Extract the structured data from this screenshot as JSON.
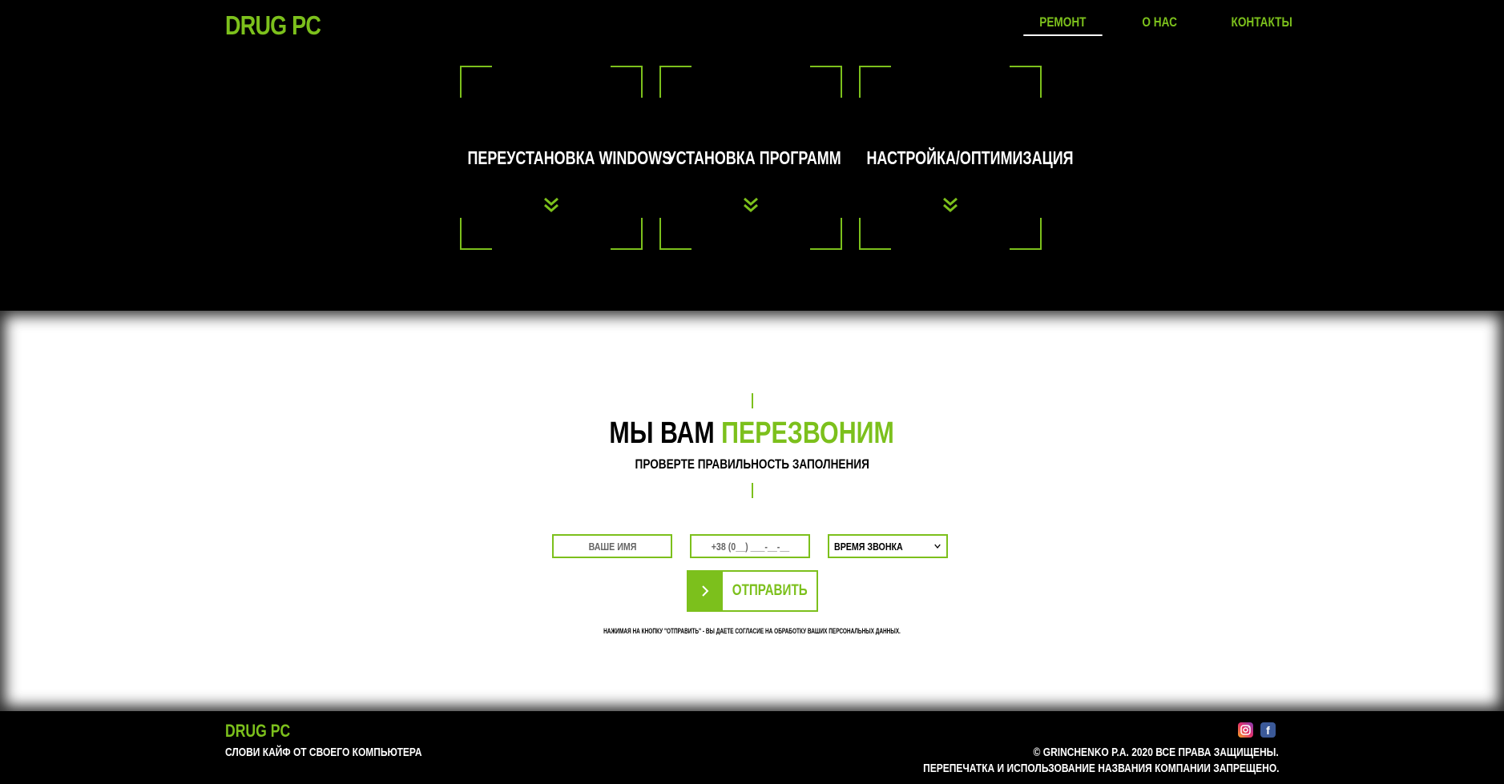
{
  "header": {
    "logo": "DRUG PC",
    "nav": [
      {
        "label": "РЕМОНТ",
        "active": true
      },
      {
        "label": "О НАС",
        "active": false
      },
      {
        "label": "КОНТАКТЫ",
        "active": false
      }
    ]
  },
  "services": [
    {
      "title": "ПЕРЕУСТАНОВКА WINDOWS",
      "icon": "double-chevron-down-icon"
    },
    {
      "title": "УСТАНОВКА ПРОГРАММ",
      "icon": "double-chevron-down-icon"
    },
    {
      "title": "НАСТРОЙКА/ОПТИМИЗАЦИЯ",
      "icon": "double-chevron-down-icon"
    }
  ],
  "callback": {
    "title_part1": "МЫ ВАМ",
    "title_part2": "ПЕРЕЗВОНИМ",
    "subtitle": "ПРОВЕРТЕ ПРАВИЛЬНОСТЬ ЗАПОЛНЕНИЯ",
    "name_placeholder": "ВАШЕ ИМЯ",
    "phone_placeholder": "+38 (0__) ___-__-__",
    "time_select": "ВРЕМЯ ЗВОНКА",
    "submit_label": "ОТПРАВИТЬ",
    "disclaimer": "НАЖИМАЯ НА КНОПКУ \"ОТПРАВИТЬ\" - ВЫ ДАЕТЕ СОГЛАСИЕ НА ОБРАБОТКУ ВАШИХ ПЕРСОНАЛЬНЫХ ДАННЫХ."
  },
  "footer": {
    "logo": "DRUG PC",
    "tagline": "СЛОВИ КАЙФ ОТ СВОЕГО КОМПЬЮТЕРА",
    "copyright": "© GRINCHENKO P.A. 2020 ВСЕ ПРАВА ЗАЩИЩЕНЫ.",
    "rights": "ПЕРЕПЕЧАТКА И ИСПОЛЬЗОВАНИЕ НАЗВАНИЯ КОМПАНИИ ЗАПРЕЩЕНО.",
    "social": [
      "instagram-icon",
      "facebook-icon"
    ]
  },
  "colors": {
    "accent": "#7cc01c",
    "background": "#000000",
    "section": "#ffffff"
  }
}
